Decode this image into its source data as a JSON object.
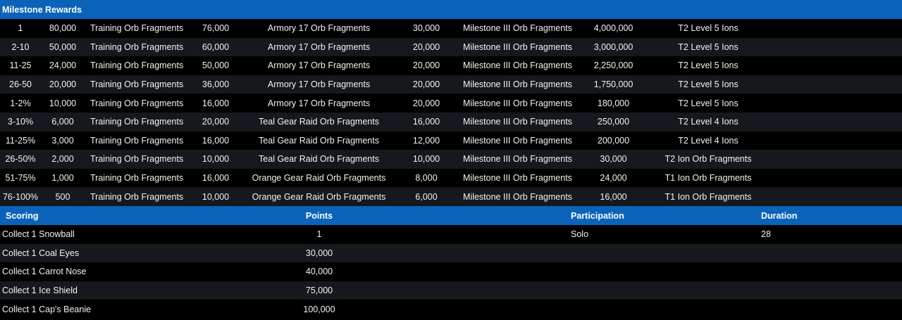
{
  "rewards_table": {
    "headers": [
      "Milestone",
      "Rewards"
    ],
    "rows": [
      [
        "1",
        "80,000",
        "Training Orb Fragments",
        "76,000",
        "Armory 17 Orb Fragments",
        "30,000",
        "Milestone III Orb Fragments",
        "4,000,000",
        "T2 Level 5 Ions"
      ],
      [
        "2-10",
        "50,000",
        "Training Orb Fragments",
        "60,000",
        "Armory 17 Orb Fragments",
        "20,000",
        "Milestone III Orb Fragments",
        "3,000,000",
        "T2 Level 5 Ions"
      ],
      [
        "11-25",
        "24,000",
        "Training Orb Fragments",
        "50,000",
        "Armory 17 Orb Fragments",
        "20,000",
        "Milestone III Orb Fragments",
        "2,250,000",
        "T2 Level 5 Ions"
      ],
      [
        "26-50",
        "20,000",
        "Training Orb Fragments",
        "36,000",
        "Armory 17 Orb Fragments",
        "20,000",
        "Milestone III Orb Fragments",
        "1,750,000",
        "T2 Level 5 Ions"
      ],
      [
        "1-2%",
        "10,000",
        "Training Orb Fragments",
        "16,000",
        "Armory 17 Orb Fragments",
        "20,000",
        "Milestone III Orb Fragments",
        "180,000",
        "T2 Level 5 Ions"
      ],
      [
        "3-10%",
        "6,000",
        "Training Orb Fragments",
        "20,000",
        "Teal Gear Raid Orb Fragments",
        "16,000",
        "Milestone III Orb Fragments",
        "250,000",
        "T2 Level 4 Ions"
      ],
      [
        "11-25%",
        "3,000",
        "Training Orb Fragments",
        "16,000",
        "Teal Gear Raid Orb Fragments",
        "12,000",
        "Milestone III Orb Fragments",
        "200,000",
        "T2 Level 4 Ions"
      ],
      [
        "26-50%",
        "2,000",
        "Training Orb Fragments",
        "10,000",
        "Teal Gear Raid Orb Fragments",
        "10,000",
        "Milestone III Orb Fragments",
        "30,000",
        "T2 Ion Orb Fragments"
      ],
      [
        "51-75%",
        "1,000",
        "Training Orb Fragments",
        "16,000",
        "Orange Gear Raid Orb Fragments",
        "8,000",
        "Milestone III Orb Fragments",
        "24,000",
        "T1 Ion Orb Fragments"
      ],
      [
        "76-100%",
        "500",
        "Training Orb Fragments",
        "10,000",
        "Orange Gear Raid Orb Fragments",
        "6,000",
        "Milestone III Orb Fragments",
        "16,000",
        "T1 Ion Orb Fragments"
      ]
    ]
  },
  "scoring_table": {
    "headers": [
      "Scoring",
      "Points",
      "Participation",
      "Duration"
    ],
    "rows": [
      [
        "Collect 1 Snowball",
        "1",
        "Solo",
        "28"
      ],
      [
        "Collect 1 Coal Eyes",
        "30,000",
        "",
        ""
      ],
      [
        "Collect 1 Carrot Nose",
        "40,000",
        "",
        ""
      ],
      [
        "Collect 1 Ice Shield",
        "75,000",
        "",
        ""
      ],
      [
        "Collect 1 Cap's Beanie",
        "100,000",
        "",
        ""
      ]
    ]
  },
  "colors": {
    "header_bg": "#0a63b8",
    "row_alt_bg": "#15191d",
    "page_bg": "#000000",
    "text": "#f2f2f2"
  }
}
